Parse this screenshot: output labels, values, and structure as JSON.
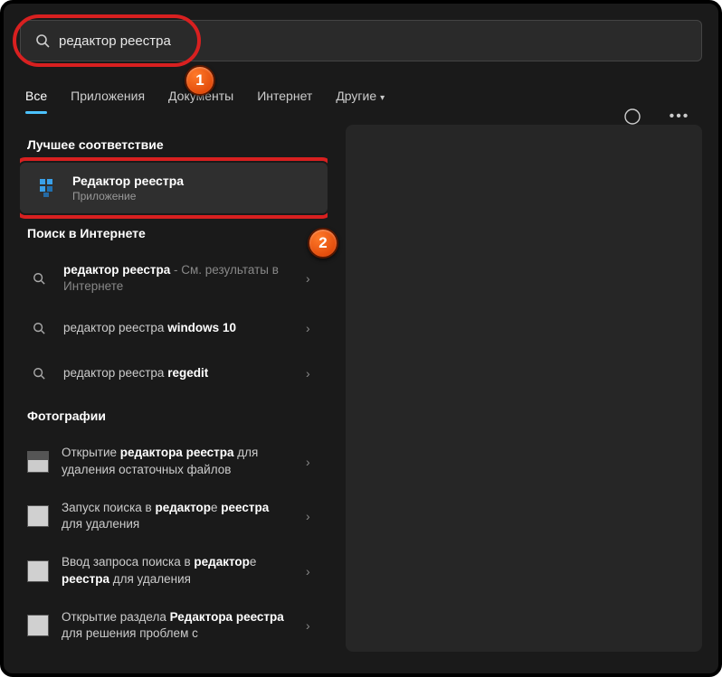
{
  "search": {
    "value": "редактор реестра",
    "placeholder": ""
  },
  "tabs": {
    "items": [
      {
        "label": "Все",
        "active": true
      },
      {
        "label": "Приложения"
      },
      {
        "label": "Документы"
      },
      {
        "label": "Интернет"
      },
      {
        "label": "Другие",
        "dropdown": true
      }
    ]
  },
  "sections": {
    "best_match": "Лучшее соответствие",
    "web": "Поиск в Интернете",
    "photos": "Фотографии"
  },
  "best": {
    "title": "Редактор реестра",
    "subtitle": "Приложение"
  },
  "web_results": [
    {
      "query": "редактор реестра",
      "note": " - См. результаты в Интернете"
    },
    {
      "prefix": "редактор реестра ",
      "bold": "windows 10"
    },
    {
      "prefix": "редактор реестра ",
      "bold": "regedit"
    }
  ],
  "photo_results": [
    {
      "p1": "Открытие ",
      "b1": "редактора реестра",
      "p2": " для удаления остаточных файлов"
    },
    {
      "p1": "Запуск поиска в ",
      "b1": "редактор",
      "p2": "е ",
      "b2": "реестра",
      "p3": " для удаления"
    },
    {
      "p1": "Ввод запроса поиска в ",
      "b1": "редактор",
      "p2": "е ",
      "b2": "реестра",
      "p3": " для удаления"
    },
    {
      "p1": "Открытие раздела ",
      "b1": "Редактора реестра",
      "p2": " для решения проблем с"
    }
  ],
  "annotations": {
    "badge1": "1",
    "badge2": "2"
  }
}
